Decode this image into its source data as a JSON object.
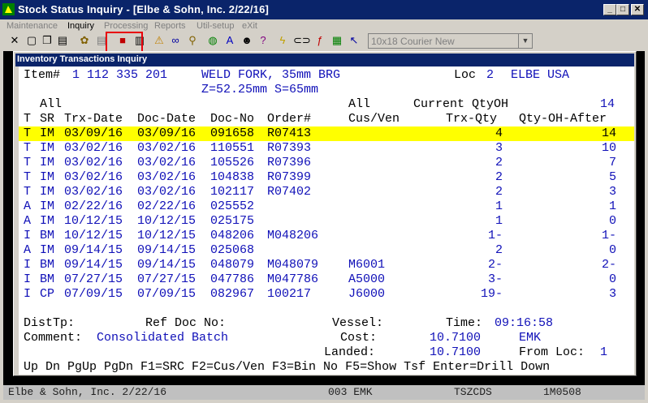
{
  "window": {
    "title": "Stock Status Inquiry - [Elbe & Sohn, Inc. 2/22/16]",
    "min": "_",
    "max": "□",
    "close": "✕"
  },
  "menu": [
    "Maintenance",
    "Inquiry",
    "Processing",
    "Reports",
    "Util-setup",
    "eXit"
  ],
  "toolbar": {
    "font_combo": "10x18 Courier New"
  },
  "dialog": {
    "title": "Inventory Transactions Inquiry"
  },
  "header": {
    "item_label": "Item#",
    "item_no": "1 112 335 201",
    "desc1": "WELD FORK, 35mm BRG",
    "desc2": "Z=52.25mm S=65mm",
    "loc_label": "Loc",
    "loc_no": "2",
    "loc_name": "ELBE USA",
    "all1": "All",
    "all2": "All",
    "current_qtyoh": "Current QtyOH",
    "qtyoh_value": "14"
  },
  "columns": {
    "t": "T",
    "sr": "SR",
    "trx_date": "Trx-Date",
    "doc_date": "Doc-Date",
    "doc_no": "Doc-No",
    "order": "Order#",
    "cusven": "Cus/Ven",
    "trx_qty": "Trx-Qty",
    "after": "Qty-OH-After"
  },
  "rows": [
    {
      "t": "T",
      "sr": "IM",
      "trx": "03/09/16",
      "doc": "03/09/16",
      "docno": "091658",
      "order": "R07413",
      "cv": "",
      "qty": "4",
      "after": "14"
    },
    {
      "t": "T",
      "sr": "IM",
      "trx": "03/02/16",
      "doc": "03/02/16",
      "docno": "110551",
      "order": "R07393",
      "cv": "",
      "qty": "3",
      "after": "10"
    },
    {
      "t": "T",
      "sr": "IM",
      "trx": "03/02/16",
      "doc": "03/02/16",
      "docno": "105526",
      "order": "R07396",
      "cv": "",
      "qty": "2",
      "after": "7"
    },
    {
      "t": "T",
      "sr": "IM",
      "trx": "03/02/16",
      "doc": "03/02/16",
      "docno": "104838",
      "order": "R07399",
      "cv": "",
      "qty": "2",
      "after": "5"
    },
    {
      "t": "T",
      "sr": "IM",
      "trx": "03/02/16",
      "doc": "03/02/16",
      "docno": "102117",
      "order": "R07402",
      "cv": "",
      "qty": "2",
      "after": "3"
    },
    {
      "t": "A",
      "sr": "IM",
      "trx": "02/22/16",
      "doc": "02/22/16",
      "docno": "025552",
      "order": "",
      "cv": "",
      "qty": "1",
      "after": "1"
    },
    {
      "t": "A",
      "sr": "IM",
      "trx": "10/12/15",
      "doc": "10/12/15",
      "docno": "025175",
      "order": "",
      "cv": "",
      "qty": "1",
      "after": "0"
    },
    {
      "t": "I",
      "sr": "BM",
      "trx": "10/12/15",
      "doc": "10/12/15",
      "docno": "048206",
      "order": "M048206",
      "cv": "",
      "qty": "1-",
      "after": "1-"
    },
    {
      "t": "A",
      "sr": "IM",
      "trx": "09/14/15",
      "doc": "09/14/15",
      "docno": "025068",
      "order": "",
      "cv": "",
      "qty": "2",
      "after": "0"
    },
    {
      "t": "I",
      "sr": "BM",
      "trx": "09/14/15",
      "doc": "09/14/15",
      "docno": "048079",
      "order": "M048079",
      "cv": "M6001",
      "qty": "2-",
      "after": "2-"
    },
    {
      "t": "I",
      "sr": "BM",
      "trx": "07/27/15",
      "doc": "07/27/15",
      "docno": "047786",
      "order": "M047786",
      "cv": "A5000",
      "qty": "3-",
      "after": "0"
    },
    {
      "t": "I",
      "sr": "CP",
      "trx": "07/09/15",
      "doc": "07/09/15",
      "docno": "082967",
      "order": "100217",
      "cv": "J6000",
      "qty": "19-",
      "after": "3"
    }
  ],
  "footer": {
    "disttp": "DistTp:",
    "refdoc": "Ref Doc No:",
    "vessel": "Vessel:",
    "time_label": "Time:",
    "time": "09:16:58",
    "comment_label": "Comment:",
    "comment": "Consolidated Batch",
    "cost_label": "Cost:",
    "cost": "10.7100",
    "cost_code": "EMK",
    "landed_label": "Landed:",
    "landed": "10.7100",
    "fromloc_label": "From Loc:",
    "fromloc": "1",
    "keys": "Up Dn PgUp PgDn F1=SRC F2=Cus/Ven F3=Bin No F5=Show Tsf Enter=Drill Down"
  },
  "status": {
    "company": "Elbe & Sohn, Inc. 2/22/16",
    "code": "003 EMK",
    "loc": "TSZCDS",
    "num": "1M0508"
  }
}
